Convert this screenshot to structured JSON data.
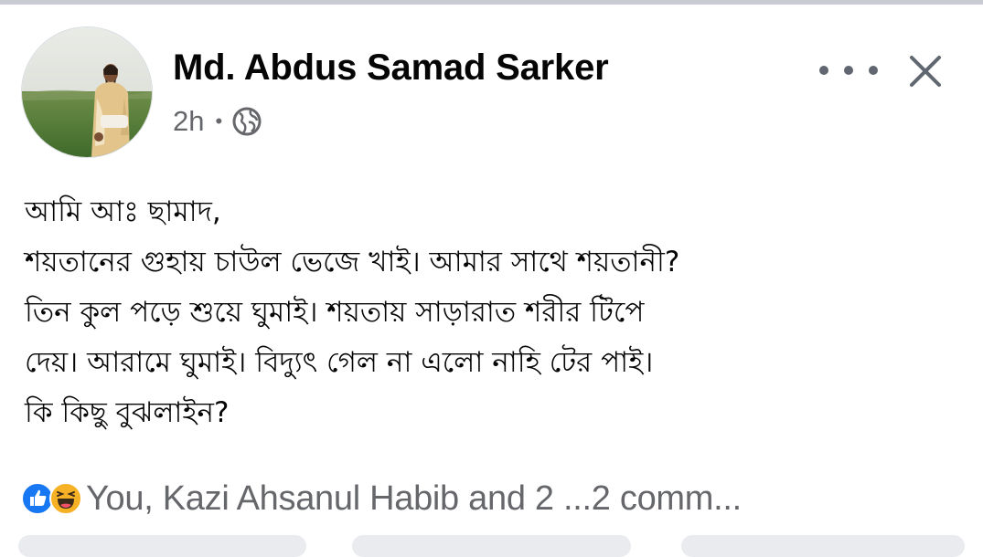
{
  "post": {
    "author_name": "Md. Abdus Samad Sarker",
    "time": "2h",
    "separator": "•",
    "privacy_icon": "globe-icon",
    "body_lines": [
      "আমি আঃ ছামাদ,",
      "শয়তানের গুহায় চাউল ভেজে খাই। আমার সাথে শয়তানী?",
      "তিন কুল পড়ে শুয়ে ঘুমাই। শয়তায় সাড়ারাত শরীর টিপে",
      "দেয়। আরামে ঘুমাই। বিদ্যুৎ গেল না এলো নাহি টের পাই।",
      "কি কিছু বুঝলাইন?"
    ]
  },
  "header_actions": {
    "more_icon": "more-horizontal-icon",
    "close_icon": "close-icon"
  },
  "reactions": {
    "icons": [
      "like-icon",
      "haha-icon"
    ],
    "summary": "You, Kazi Ahsanul Habib and 2 ...",
    "comments": "2 comm..."
  },
  "colors": {
    "text": "#050505",
    "secondary_text": "#65676b",
    "like_blue": "#1877f2",
    "haha_yellow": "#f7b125",
    "icon_gray": "#606770"
  }
}
